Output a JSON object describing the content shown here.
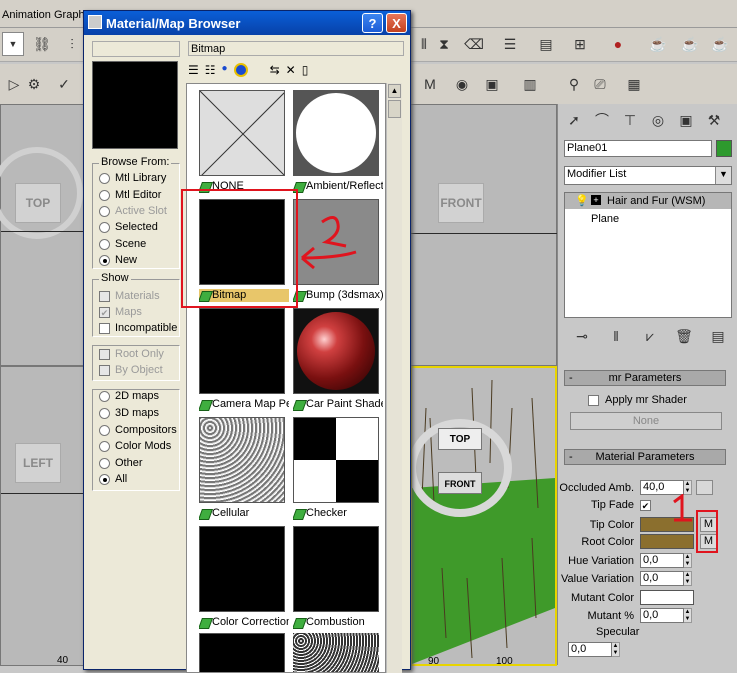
{
  "top_menu": {
    "item1": "Animation",
    "item2": "Graph"
  },
  "dialog": {
    "title": "Material/Map Browser",
    "help_btn": "?",
    "close_btn": "X",
    "current_name": "Bitmap",
    "browse_from": {
      "title": "Browse From:",
      "options": [
        "Mtl Library",
        "Mtl Editor",
        "Active Slot",
        "Selected",
        "Scene",
        "New"
      ],
      "selected": "New"
    },
    "show": {
      "title": "Show",
      "options": [
        "Materials",
        "Maps",
        "Incompatible"
      ],
      "checked": [
        "Maps"
      ]
    },
    "root_only": "Root Only",
    "by_object": "By Object",
    "categories": [
      "2D maps",
      "3D maps",
      "Compositors",
      "Color Mods",
      "Other",
      "All"
    ],
    "category_selected": "All",
    "tiles": [
      {
        "label": "NONE"
      },
      {
        "label": "Ambient/Reflecti"
      },
      {
        "label": "Bitmap"
      },
      {
        "label": "Bump (3dsmax)"
      },
      {
        "label": "Camera Map Per"
      },
      {
        "label": "Car Paint Shader"
      },
      {
        "label": "Cellular"
      },
      {
        "label": "Checker"
      },
      {
        "label": "Color Correction"
      },
      {
        "label": "Combustion"
      }
    ]
  },
  "viewports": {
    "top": "TOP",
    "front": "FRONT",
    "left": "LEFT",
    "persp_cube_top": "TOP",
    "persp_cube_front": "FRONT",
    "ruler_a": "40",
    "ruler_b": "90",
    "ruler_c": "100"
  },
  "command_panel": {
    "object_name": "Plane01",
    "modifier_list": "Modifier List",
    "stack": [
      "Hair and Fur (WSM)",
      "Plane"
    ],
    "mr_rollout": "mr Parameters",
    "apply_mr": "Apply mr Shader",
    "none_btn": "None",
    "mat_rollout": "Material Parameters",
    "occluded_amb": {
      "label": "Occluded Amb.",
      "value": "40,0"
    },
    "tip_fade": {
      "label": "Tip Fade",
      "checked": true
    },
    "tip_color": {
      "label": "Tip Color",
      "color": "#8b6f2e"
    },
    "root_color": {
      "label": "Root Color",
      "color": "#8b6f2e"
    },
    "hue_variation": {
      "label": "Hue Variation",
      "value": "0,0"
    },
    "value_variation": {
      "label": "Value Variation",
      "value": "0,0"
    },
    "mutant_color": {
      "label": "Mutant Color",
      "color": "#ffffff"
    },
    "mutant_pct": {
      "label": "Mutant %",
      "value": "0,0"
    },
    "specular": {
      "label": "Specular",
      "value": "0,0"
    },
    "m_label": "M"
  },
  "annotations": {
    "one": "1",
    "two": "2"
  },
  "colors": {
    "accent_red": "#e0141e",
    "title_blue": "#0a5fd8",
    "green_swatch": "#2e9a2e"
  }
}
